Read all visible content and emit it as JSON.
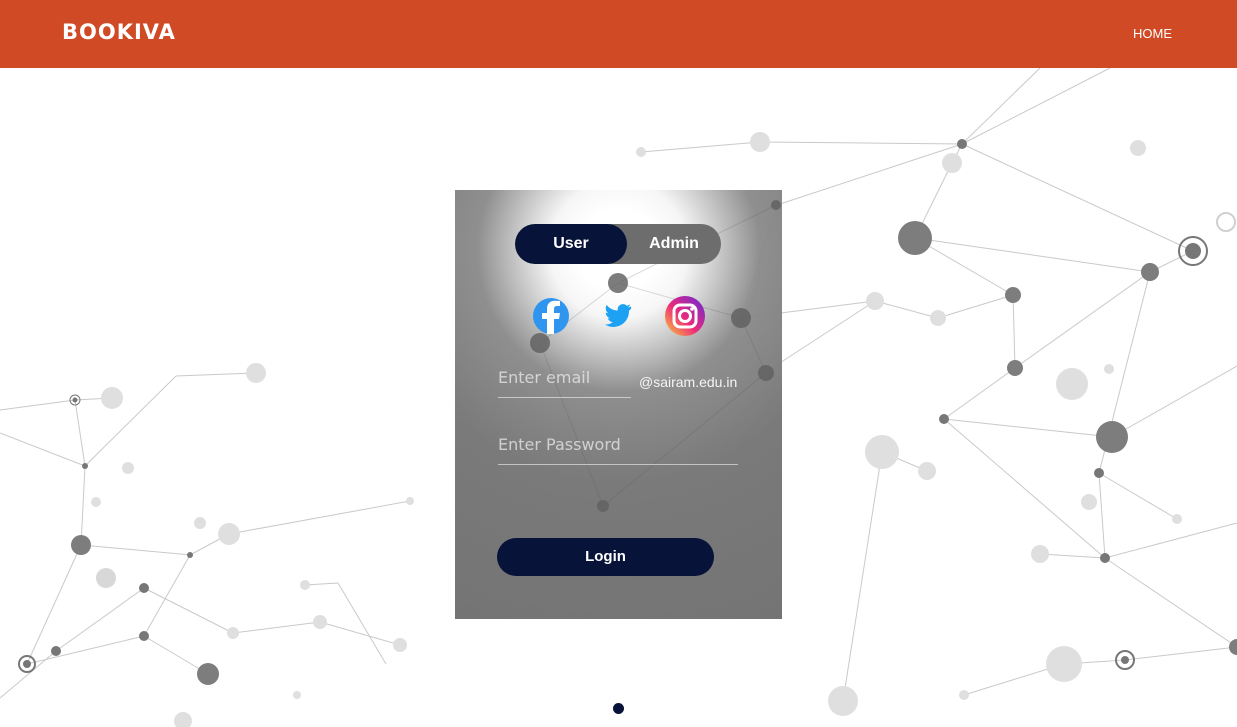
{
  "app": {
    "title": "BOOKIVA",
    "brand_color": "#d04a25"
  },
  "nav": {
    "home": "HOME"
  },
  "login": {
    "toggle": {
      "user": "User",
      "admin": "Admin",
      "active": "User"
    },
    "social": [
      {
        "name": "facebook-icon"
      },
      {
        "name": "twitter-icon"
      },
      {
        "name": "instagram-icon"
      }
    ],
    "email": {
      "placeholder": "Enter email",
      "domain": "@sairam.edu.in"
    },
    "password": {
      "placeholder": "Enter Password"
    },
    "button": "Login"
  },
  "colors": {
    "accent": "#071338",
    "panel": "#757575"
  },
  "carousel": {
    "active_index": 1
  }
}
